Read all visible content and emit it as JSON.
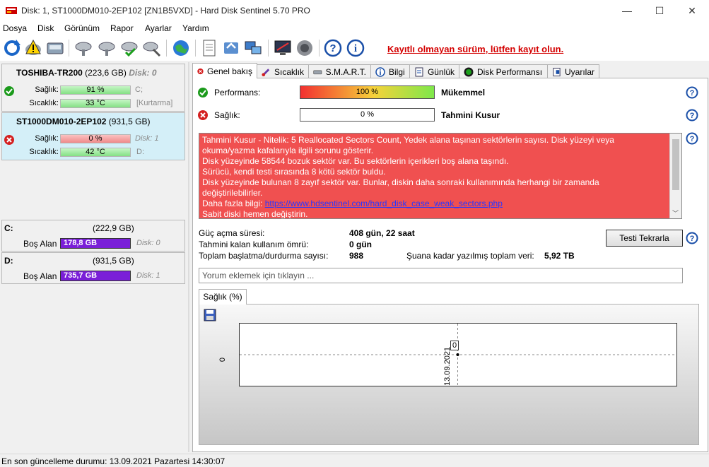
{
  "window": {
    "title": "Disk: 1, ST1000DM010-2EP102 [ZN1B5VXD]  -  Hard Disk Sentinel 5.70 PRO",
    "minimize": "—",
    "maximize": "☐",
    "close": "✕"
  },
  "menu": [
    "Dosya",
    "Disk",
    "Görünüm",
    "Rapor",
    "Ayarlar",
    "Yardım"
  ],
  "toolbar": {
    "icons": [
      "refresh-icon",
      "warning-disk-icon",
      "disk-info-icon",
      "disk-tool-1-icon",
      "disk-tool-2-icon",
      "disk-check-icon",
      "disk-settings-icon",
      "web-icon",
      "report-icon",
      "transfer-icon",
      "network-icon",
      "monitor-icon",
      "speaker-icon",
      "help-icon",
      "about-icon"
    ],
    "register_text": "Kayıtlı olmayan sürüm, lütfen kayıt olun."
  },
  "disks": [
    {
      "name": "TOSHIBA-TR200",
      "size": "(223,6 GB)",
      "index": "Disk: 0",
      "health_label": "Sağlık:",
      "health_value": "91 %",
      "health_percent": 91,
      "temp_label": "Sıcaklık:",
      "temp_value": "33 °C",
      "drive_tag": "C;",
      "temp_tag": "[Kurtarma]",
      "status": "ok"
    },
    {
      "name": "ST1000DM010-2EP102",
      "size": "(931,5 GB)",
      "index": "Disk: 1",
      "health_label": "Sağlık:",
      "health_value": "0 %",
      "health_percent": 0,
      "temp_label": "Sıcaklık:",
      "temp_value": "42 °C",
      "drive_tag": "Disk: 1",
      "temp_tag": "D:",
      "status": "bad"
    }
  ],
  "volumes": [
    {
      "letter": "C:",
      "size": "(222,9 GB)",
      "free_label": "Boş Alan",
      "free_value": "178,8 GB",
      "disk": "Disk: 0"
    },
    {
      "letter": "D:",
      "size": "(931,5 GB)",
      "free_label": "Boş Alan",
      "free_value": "735,7 GB",
      "disk": "Disk: 1"
    }
  ],
  "tabs": [
    {
      "label": "Genel bakış",
      "icon": "error-icon",
      "active": true
    },
    {
      "label": "Sıcaklık",
      "icon": "thermometer-icon",
      "active": false
    },
    {
      "label": "S.M.A.R.T.",
      "icon": "smart-icon",
      "active": false
    },
    {
      "label": "Bilgi",
      "icon": "info-icon",
      "active": false
    },
    {
      "label": "Günlük",
      "icon": "log-icon",
      "active": false
    },
    {
      "label": "Disk Performansı",
      "icon": "performance-icon",
      "active": false
    },
    {
      "label": "Uyarılar",
      "icon": "alerts-icon",
      "active": false
    }
  ],
  "overview": {
    "performance_label": "Performans:",
    "performance_value": "100 %",
    "performance_percent": 100,
    "performance_rating": "Mükemmel",
    "health_label": "Sağlık:",
    "health_value": "0 %",
    "health_percent": 0,
    "health_rating": "Tahmini Kusur",
    "info_lines": [
      "Tahmini Kusur - Nitelik: 5 Reallocated Sectors Count, Yedek alana taşınan sektörlerin sayısı. Disk yüzeyi veya",
      "okuma/yazma kafalarıyla ilgili sorunu gösterir.",
      "Disk yüzeyinde 58544 bozuk sektör var. Bu sektörlerin içerikleri boş alana taşındı.",
      "Sürücü, kendi testi sırasında 8 kötü sektör buldu.",
      "Disk yüzeyinde bulunan 8 zayıf sektör var. Bunlar, diskin daha sonraki kullanımında herhangi bir zamanda",
      "değiştirilebilirler."
    ],
    "info_more_prefix": "Daha fazla bilgi: ",
    "info_link": "https://www.hdsentinel.com/hard_disk_case_weak_sectors.php",
    "info_last": "Sabit diski hemen değiştirin.",
    "power_on_label": "Güç açma süresi:",
    "power_on_value": "408 gün, 22 saat",
    "remaining_label": "Tahmini kalan kullanım ömrü:",
    "remaining_value": "0 gün",
    "start_stop_label": "Toplam başlatma/durdurma sayısı:",
    "start_stop_value": "988",
    "written_label": "Şuana kadar yazılmış toplam veri:",
    "written_value": "5,92 TB",
    "retest_button": "Testi Tekrarla",
    "comment_placeholder": "Yorum eklemek için tıklayın ..."
  },
  "chart_tab": "Sağlık (%)",
  "chart_data": {
    "type": "line",
    "title": "",
    "x": [
      "13.09.2021"
    ],
    "series": [
      {
        "values": [
          0
        ]
      }
    ],
    "y_tick": "0",
    "data_label": "0",
    "grid": true
  },
  "status": {
    "text": "En son güncelleme durumu: 13.09.2021 Pazartesi 14:30:07"
  },
  "colors": {
    "alert_red": "#f05050",
    "register_red": "#d40000",
    "health_green": "#84e084",
    "volume_purple": "#7a1fd8"
  }
}
